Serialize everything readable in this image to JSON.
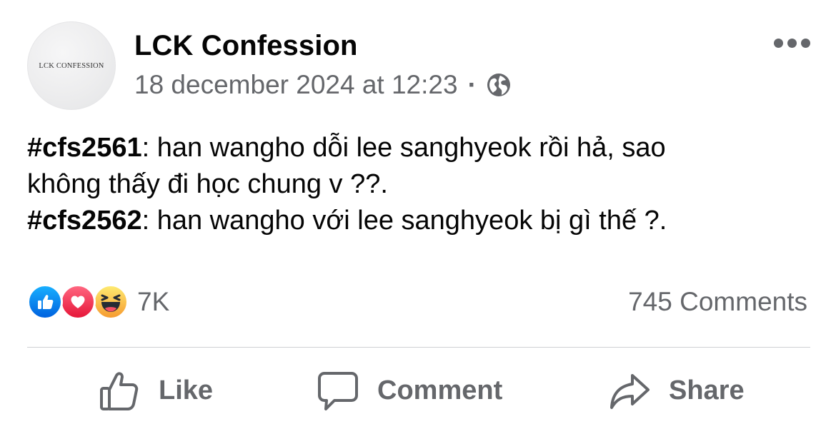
{
  "post": {
    "page_name": "LCK Confession",
    "avatar_text": "LCK CONFESSION",
    "timestamp": "18 december 2024 at 12:23",
    "separator": "·",
    "privacy_icon": "globe-icon",
    "more_icon": "more-options-icon",
    "body": [
      {
        "hashtag": "#cfs2561",
        "text": ": han wangho dỗi lee sanghyeok rồi hả, sao"
      },
      {
        "hashtag": "",
        "text": "không thấy đi học chung v ??."
      },
      {
        "hashtag": "#cfs2562",
        "text": ": han wangho với lee sanghyeok bị gì thế ?."
      }
    ]
  },
  "reactions": {
    "types": [
      "like",
      "love",
      "haha"
    ],
    "count": "7K",
    "colors": {
      "like": "#0866ff",
      "love": "#f33e58",
      "haha": "#f7b125"
    }
  },
  "comments": {
    "count_label": "745 Comments"
  },
  "actions": {
    "like_label": "Like",
    "comment_label": "Comment",
    "share_label": "Share"
  },
  "colors": {
    "text_primary": "#050505",
    "text_secondary": "#65676b",
    "divider": "#ced0d4"
  }
}
